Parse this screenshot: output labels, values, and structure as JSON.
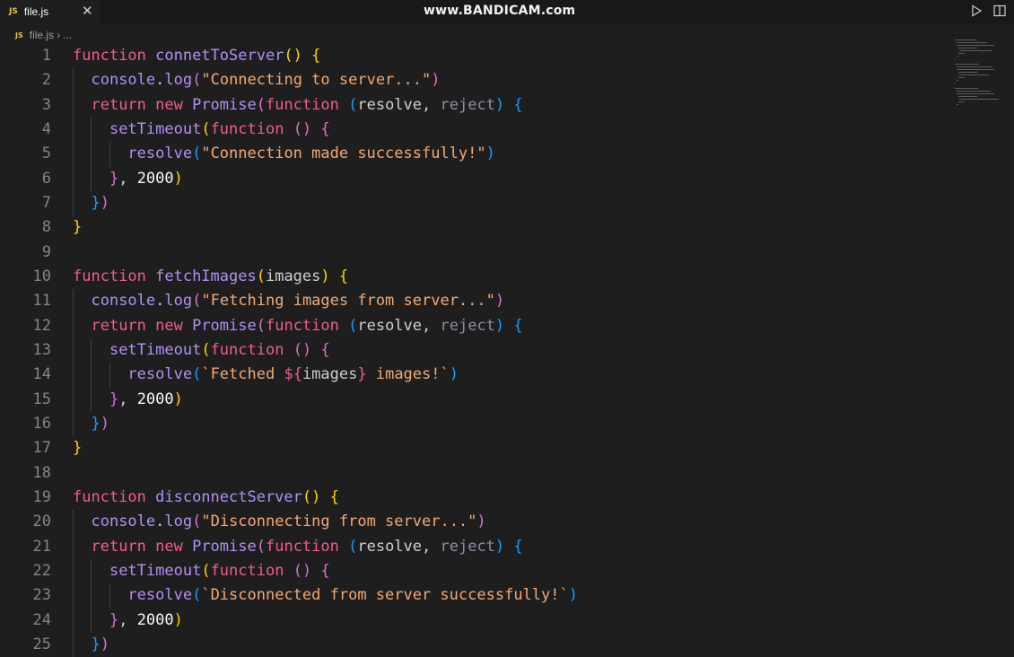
{
  "tab": {
    "badge": "JS",
    "name": "file.js",
    "close": "✕"
  },
  "watermark": "www.BANDICAM.com",
  "breadcrumb": {
    "badge": "JS",
    "file": "file.js",
    "sep": "›",
    "more": "..."
  },
  "code_lines": [
    {
      "n": "1",
      "tokens": [
        [
          "kw",
          "function "
        ],
        [
          "fn",
          "connetToServer"
        ],
        [
          "b1",
          "() {"
        ]
      ]
    },
    {
      "n": "2",
      "tokens": [
        [
          "txt",
          "  "
        ],
        [
          "fn",
          "console"
        ],
        [
          "txt",
          "."
        ],
        [
          "fn",
          "log"
        ],
        [
          "b2",
          "("
        ],
        [
          "str",
          "\"Connecting to server...\""
        ],
        [
          "b2",
          ")"
        ]
      ]
    },
    {
      "n": "3",
      "tokens": [
        [
          "txt",
          "  "
        ],
        [
          "kw",
          "return new "
        ],
        [
          "fn",
          "Promise"
        ],
        [
          "b2",
          "("
        ],
        [
          "kw",
          "function "
        ],
        [
          "b3",
          "("
        ],
        [
          "par",
          "resolve"
        ],
        [
          "txt",
          ", "
        ],
        [
          "prm",
          "reject"
        ],
        [
          "b3",
          ") {"
        ]
      ]
    },
    {
      "n": "4",
      "tokens": [
        [
          "txt",
          "    "
        ],
        [
          "fn",
          "setTimeout"
        ],
        [
          "b1",
          "("
        ],
        [
          "kw",
          "function "
        ],
        [
          "b2",
          "() {"
        ]
      ]
    },
    {
      "n": "5",
      "tokens": [
        [
          "txt",
          "      "
        ],
        [
          "fn",
          "resolve"
        ],
        [
          "b3",
          "("
        ],
        [
          "str",
          "\"Connection made successfully!\""
        ],
        [
          "b3",
          ")"
        ]
      ]
    },
    {
      "n": "6",
      "tokens": [
        [
          "txt",
          "    "
        ],
        [
          "b2",
          "}"
        ],
        [
          "txt",
          ", "
        ],
        [
          "num",
          "2000"
        ],
        [
          "b1",
          ")"
        ]
      ]
    },
    {
      "n": "7",
      "tokens": [
        [
          "txt",
          "  "
        ],
        [
          "b3",
          "}"
        ],
        [
          "b2",
          ")"
        ]
      ]
    },
    {
      "n": "8",
      "tokens": [
        [
          "b1",
          "}"
        ]
      ]
    },
    {
      "n": "9",
      "tokens": []
    },
    {
      "n": "10",
      "tokens": [
        [
          "kw",
          "function "
        ],
        [
          "fn",
          "fetchImages"
        ],
        [
          "b1",
          "("
        ],
        [
          "par",
          "images"
        ],
        [
          "b1",
          ") {"
        ]
      ]
    },
    {
      "n": "11",
      "tokens": [
        [
          "txt",
          "  "
        ],
        [
          "fn",
          "console"
        ],
        [
          "txt",
          "."
        ],
        [
          "fn",
          "log"
        ],
        [
          "b2",
          "("
        ],
        [
          "str",
          "\"Fetching images from server...\""
        ],
        [
          "b2",
          ")"
        ]
      ]
    },
    {
      "n": "12",
      "tokens": [
        [
          "txt",
          "  "
        ],
        [
          "kw",
          "return new "
        ],
        [
          "fn",
          "Promise"
        ],
        [
          "b2",
          "("
        ],
        [
          "kw",
          "function "
        ],
        [
          "b3",
          "("
        ],
        [
          "par",
          "resolve"
        ],
        [
          "txt",
          ", "
        ],
        [
          "prm",
          "reject"
        ],
        [
          "b3",
          ") {"
        ]
      ]
    },
    {
      "n": "13",
      "tokens": [
        [
          "txt",
          "    "
        ],
        [
          "fn",
          "setTimeout"
        ],
        [
          "b1",
          "("
        ],
        [
          "kw",
          "function "
        ],
        [
          "b2",
          "() {"
        ]
      ]
    },
    {
      "n": "14",
      "tokens": [
        [
          "txt",
          "      "
        ],
        [
          "fn",
          "resolve"
        ],
        [
          "b3",
          "("
        ],
        [
          "str",
          "`Fetched "
        ],
        [
          "kw",
          "${"
        ],
        [
          "par",
          "images"
        ],
        [
          "kw",
          "}"
        ],
        [
          "str",
          " images!`"
        ],
        [
          "b3",
          ")"
        ]
      ]
    },
    {
      "n": "15",
      "tokens": [
        [
          "txt",
          "    "
        ],
        [
          "b2",
          "}"
        ],
        [
          "txt",
          ", "
        ],
        [
          "num",
          "2000"
        ],
        [
          "b1",
          ")"
        ]
      ]
    },
    {
      "n": "16",
      "tokens": [
        [
          "txt",
          "  "
        ],
        [
          "b3",
          "}"
        ],
        [
          "b2",
          ")"
        ]
      ]
    },
    {
      "n": "17",
      "tokens": [
        [
          "b1",
          "}"
        ]
      ]
    },
    {
      "n": "18",
      "tokens": []
    },
    {
      "n": "19",
      "tokens": [
        [
          "kw",
          "function "
        ],
        [
          "fn",
          "disconnectServer"
        ],
        [
          "b1",
          "() {"
        ]
      ]
    },
    {
      "n": "20",
      "tokens": [
        [
          "txt",
          "  "
        ],
        [
          "fn",
          "console"
        ],
        [
          "txt",
          "."
        ],
        [
          "fn",
          "log"
        ],
        [
          "b2",
          "("
        ],
        [
          "str",
          "\"Disconnecting from server...\""
        ],
        [
          "b2",
          ")"
        ]
      ]
    },
    {
      "n": "21",
      "tokens": [
        [
          "txt",
          "  "
        ],
        [
          "kw",
          "return new "
        ],
        [
          "fn",
          "Promise"
        ],
        [
          "b2",
          "("
        ],
        [
          "kw",
          "function "
        ],
        [
          "b3",
          "("
        ],
        [
          "par",
          "resolve"
        ],
        [
          "txt",
          ", "
        ],
        [
          "prm",
          "reject"
        ],
        [
          "b3",
          ") {"
        ]
      ]
    },
    {
      "n": "22",
      "tokens": [
        [
          "txt",
          "    "
        ],
        [
          "fn",
          "setTimeout"
        ],
        [
          "b1",
          "("
        ],
        [
          "kw",
          "function "
        ],
        [
          "b2",
          "() {"
        ]
      ]
    },
    {
      "n": "23",
      "tokens": [
        [
          "txt",
          "      "
        ],
        [
          "fn",
          "resolve"
        ],
        [
          "b3",
          "("
        ],
        [
          "str",
          "`Disconnected from server successfully!`"
        ],
        [
          "b3",
          ")"
        ]
      ]
    },
    {
      "n": "24",
      "tokens": [
        [
          "txt",
          "    "
        ],
        [
          "b2",
          "}"
        ],
        [
          "txt",
          ", "
        ],
        [
          "num",
          "2000"
        ],
        [
          "b1",
          ")"
        ]
      ]
    },
    {
      "n": "25",
      "tokens": [
        [
          "txt",
          "  "
        ],
        [
          "b3",
          "}"
        ],
        [
          "b2",
          ")"
        ]
      ]
    }
  ],
  "icons": {
    "run": "play-icon",
    "split": "split-editor-icon"
  }
}
